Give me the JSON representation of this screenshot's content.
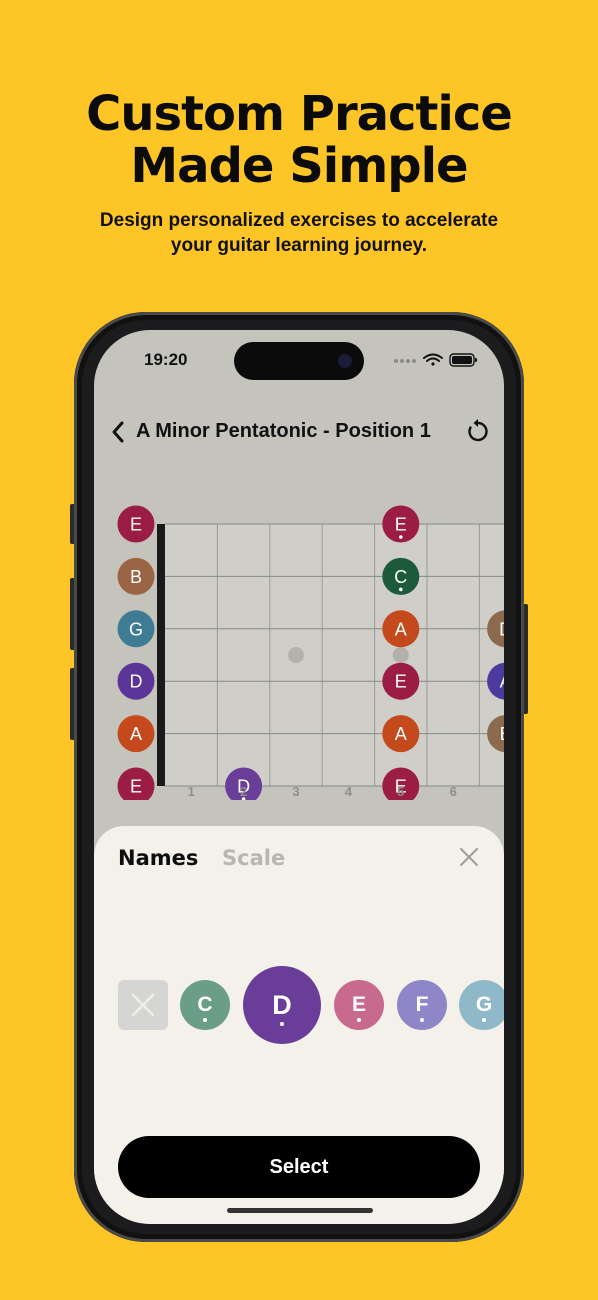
{
  "promo": {
    "headline_line1": "Custom Practice",
    "headline_line2": "Made Simple",
    "subhead_line1": "Design personalized exercises to accelerate",
    "subhead_line2": "your guitar learning journey."
  },
  "status_bar": {
    "time": "19:20"
  },
  "nav": {
    "title": "A Minor Pentatonic - Position 1",
    "back_icon": "chevron-left-icon",
    "reset_icon": "reset-icon"
  },
  "fretboard": {
    "open_strings": [
      "E",
      "B",
      "G",
      "D",
      "A",
      "E"
    ],
    "string_colors": [
      "#9b1d45",
      "#9a6545",
      "#3f7c93",
      "#5b3597",
      "#c4491c",
      "#9b1d45"
    ],
    "fret_numbers": [
      "1",
      "2",
      "3",
      "4",
      "5",
      "6"
    ],
    "notes": [
      {
        "fret": 5,
        "string": 0,
        "label": "E",
        "color": "#9b1d45",
        "root": true
      },
      {
        "fret": 5,
        "string": 1,
        "label": "C",
        "color": "#1c5a3b",
        "root": true
      },
      {
        "fret": 5,
        "string": 2,
        "label": "A",
        "color": "#c4491c",
        "root": false
      },
      {
        "fret": 5,
        "string": 3,
        "label": "E",
        "color": "#9b1d45",
        "root": false
      },
      {
        "fret": 5,
        "string": 4,
        "label": "A",
        "color": "#c4491c",
        "root": false
      },
      {
        "fret": 5,
        "string": 5,
        "label": "E",
        "color": "#9b1d45",
        "root": false
      },
      {
        "fret": 2,
        "string": 5,
        "label": "D",
        "color": "#6a3d98",
        "root": true
      },
      {
        "fret": 7,
        "string": 2,
        "label": "D",
        "color": "#8c6a4e",
        "root": false
      },
      {
        "fret": 7,
        "string": 3,
        "label": "A",
        "color": "#4c3a9e",
        "root": false
      },
      {
        "fret": 7,
        "string": 4,
        "label": "B",
        "color": "#8c6a4e",
        "root": false
      }
    ],
    "inlay_frets": [
      3,
      5
    ]
  },
  "sheet": {
    "tab_names": "Names",
    "tab_scale": "Scale",
    "close_icon": "close-icon",
    "clear_icon": "clear-x-icon",
    "chips": [
      {
        "label": "C",
        "color": "#6a9e86"
      },
      {
        "label": "D",
        "color": "#6a3d98",
        "selected": true
      },
      {
        "label": "E",
        "color": "#c76a8d"
      },
      {
        "label": "F",
        "color": "#8f86c8"
      },
      {
        "label": "G",
        "color": "#8fb8c9"
      }
    ],
    "select_label": "Select"
  }
}
